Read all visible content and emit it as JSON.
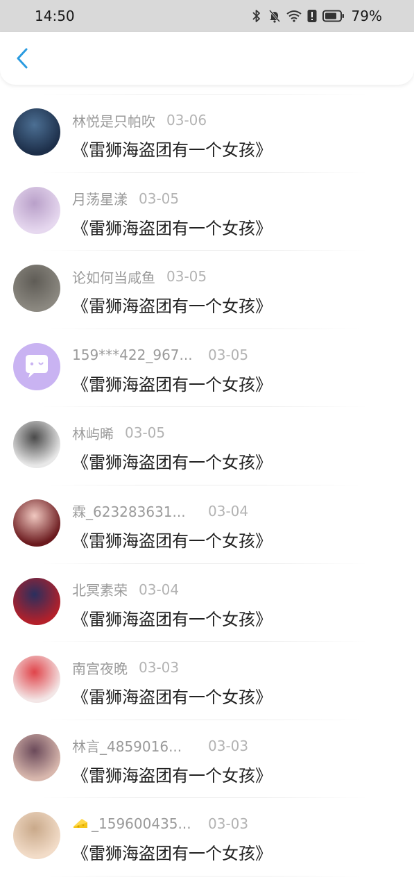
{
  "status_bar": {
    "time": "14:50",
    "battery": "79%"
  },
  "comments": [
    {
      "name": "林悦是只帕吹",
      "date": "03-06",
      "text": "《雷狮海盗团有一个女孩》",
      "avatar_icon": "avatar-dark-character",
      "avatar_colors": [
        "#1d2f4a",
        "#4c6f93"
      ]
    },
    {
      "name": "月荡星漾",
      "date": "03-05",
      "text": "《雷狮海盗团有一个女孩》",
      "avatar_icon": "avatar-anime-girl-lavender",
      "avatar_colors": [
        "#e6d8ef",
        "#b9a0c9"
      ]
    },
    {
      "name": "论如何当咸鱼",
      "date": "03-05",
      "text": "《雷狮海盗团有一个女孩》",
      "avatar_icon": "avatar-street-photo",
      "avatar_colors": [
        "#8b8880",
        "#5f5c56"
      ]
    },
    {
      "name": "159***422_967...",
      "date": "03-05",
      "text": "《雷狮海盗团有一个女孩》",
      "avatar_icon": "avatar-default-chat-bubble",
      "avatar_colors": [
        "#c9b3f2",
        "#ffffff"
      ]
    },
    {
      "name": "林屿晞",
      "date": "03-05",
      "text": "《雷狮海盗团有一个女孩》",
      "avatar_icon": "avatar-monochrome-girl",
      "avatar_colors": [
        "#e8e8e8",
        "#4a4a4a"
      ]
    },
    {
      "name": "霖_623283631...",
      "date": "03-04",
      "text": "《雷狮海盗团有一个女孩》",
      "avatar_icon": "avatar-red-anime-girl",
      "avatar_colors": [
        "#6b1a1e",
        "#f0c8c0"
      ]
    },
    {
      "name": "北冥素荣",
      "date": "03-04",
      "text": "《雷狮海盗团有一个女孩》",
      "avatar_icon": "avatar-red-ornaments",
      "avatar_colors": [
        "#b3202a",
        "#2a2f5e"
      ]
    },
    {
      "name": "南宫夜晚",
      "date": "03-03",
      "text": "《雷狮海盗团有一个女孩》",
      "avatar_icon": "avatar-red-hair-girl",
      "avatar_colors": [
        "#f3e6e6",
        "#e0444a"
      ]
    },
    {
      "name": "林言_4859016...",
      "date": "03-03",
      "text": "《雷狮海盗团有一个女孩》",
      "avatar_icon": "avatar-anime-couple",
      "avatar_colors": [
        "#d8b7ad",
        "#6b4a5a"
      ]
    },
    {
      "name": "_159600435...",
      "name_prefix_icon": "cheese-icon",
      "date": "03-03",
      "text": "《雷狮海盗团有一个女孩》",
      "avatar_icon": "avatar-blonde-girl",
      "avatar_colors": [
        "#f2dcc8",
        "#c9a98a"
      ]
    }
  ]
}
